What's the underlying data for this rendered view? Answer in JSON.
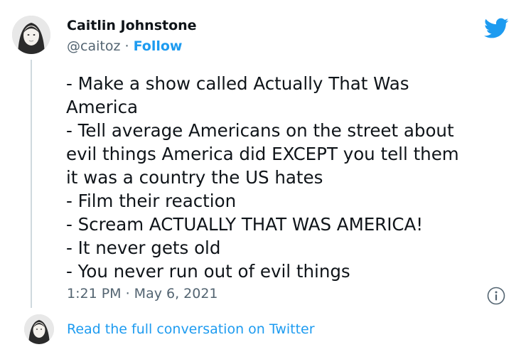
{
  "author": {
    "display_name": "Caitlin Johnstone",
    "handle": "@caitoz",
    "separator": "·",
    "follow_label": "Follow"
  },
  "tweet": {
    "lines": [
      "- Make a show called Actually That Was",
      "America",
      "- Tell average Americans on the street about",
      "evil things America did EXCEPT you tell them",
      "it was a country the US hates",
      "- Film their reaction",
      "- Scream ACTUALLY THAT WAS AMERICA!",
      "- It never gets old",
      "- You never run out of evil things"
    ],
    "timestamp": "1:21 PM · May 6, 2021"
  },
  "footer": {
    "read_label": "Read the full conversation on Twitter"
  },
  "icons": {
    "logo": "twitter-bird-icon",
    "info": "info-icon"
  },
  "colors": {
    "accent": "#1d9bf0",
    "secondary_text": "#536471",
    "primary_text": "#0f1419",
    "thread_line": "#cfd9de"
  }
}
